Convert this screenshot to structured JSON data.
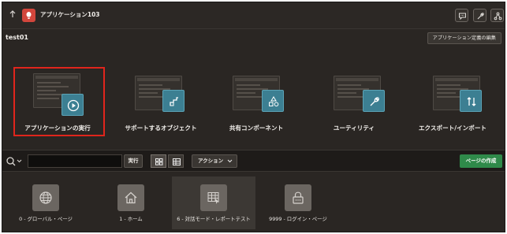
{
  "header": {
    "app_title": "アプリケーション103",
    "up_icon": "arrow-up-icon",
    "app_icon": "lamp-icon",
    "right_icons": [
      "chat-icon",
      "wrench-icon",
      "share-icon"
    ]
  },
  "page": {
    "name": "test01",
    "edit_definition_label": "アプリケーション定義の編集"
  },
  "tiles": [
    {
      "label": "アプリケーションの実行",
      "icon": "play-icon",
      "selected": true
    },
    {
      "label": "サポートするオブジェクト",
      "icon": "objects-icon",
      "selected": false
    },
    {
      "label": "共有コンポーネント",
      "icon": "shapes-icon",
      "selected": false
    },
    {
      "label": "ユーティリティ",
      "icon": "wrench-icon",
      "selected": false
    },
    {
      "label": "エクスポート/インポート",
      "icon": "swap-arrows-icon",
      "selected": false
    }
  ],
  "toolbar": {
    "search_value": "",
    "search_placeholder": "",
    "go_label": "実行",
    "actions_label": "アクション",
    "create_page_label": "ページの作成"
  },
  "pages": [
    {
      "label": "0 - グローバル・ページ",
      "icon": "globe-icon"
    },
    {
      "label": "1 - ホーム",
      "icon": "home-icon"
    },
    {
      "label": "6 - 対話モード・レポートテスト",
      "icon": "report-grid-icon"
    },
    {
      "label": "9999 - ログイン・ページ",
      "icon": "lock-icon"
    }
  ],
  "colors": {
    "background": "#2a2623",
    "accent_teal": "#3c7f92",
    "app_badge_red": "#d2463c",
    "create_green": "#2f8a4a",
    "selection_red": "#e0251c"
  }
}
